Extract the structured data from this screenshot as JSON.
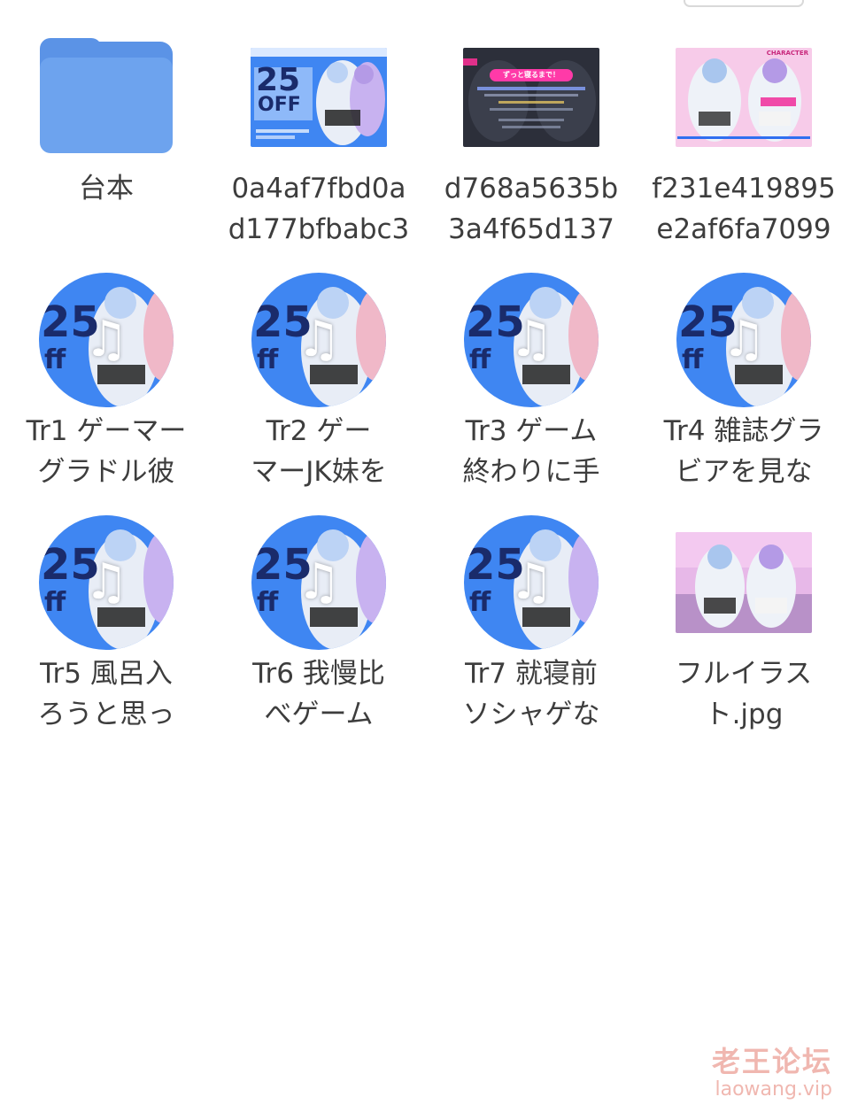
{
  "files": [
    {
      "name": "台本",
      "kind": "folder"
    },
    {
      "name": "0a4af7fbd0a\nd177bfbabc3",
      "kind": "image",
      "thumb": "banner-25off"
    },
    {
      "name": "d768a5635b\n3a4f65d137",
      "kind": "image",
      "thumb": "dark-notice"
    },
    {
      "name": "f231e419895\ne2af6fa7099",
      "kind": "image",
      "thumb": "character-pink"
    },
    {
      "name": "Tr1 ゲーマー\nグラドル彼",
      "kind": "audio"
    },
    {
      "name": "Tr2 ゲー\nマーJK妹を",
      "kind": "audio"
    },
    {
      "name": "Tr3 ゲーム\n終わりに手",
      "kind": "audio"
    },
    {
      "name": "Tr4 雑誌グラ\nビアを見な",
      "kind": "audio"
    },
    {
      "name": "Tr5 風呂入\nろうと思っ",
      "kind": "audio"
    },
    {
      "name": "Tr6 我慢比\nべゲーム",
      "kind": "audio"
    },
    {
      "name": "Tr7 就寝前\nソシャゲな",
      "kind": "audio"
    },
    {
      "name": "フルイラス\nト.jpg",
      "kind": "image",
      "thumb": "full-illust"
    }
  ],
  "thumb_text": {
    "off_big": "25",
    "off_word": "OFF",
    "notice_pill": "ずっと寝るまで！",
    "character_tag": "CHARACTER",
    "music_note": "♫"
  },
  "watermark": {
    "line1": "老王论坛",
    "line2": "laowang.vip"
  },
  "colors": {
    "folder": "#5b93e6",
    "label": "#3d3d3d",
    "watermark": "#f0b7b0",
    "accent_blue": "#2f6ff0"
  }
}
